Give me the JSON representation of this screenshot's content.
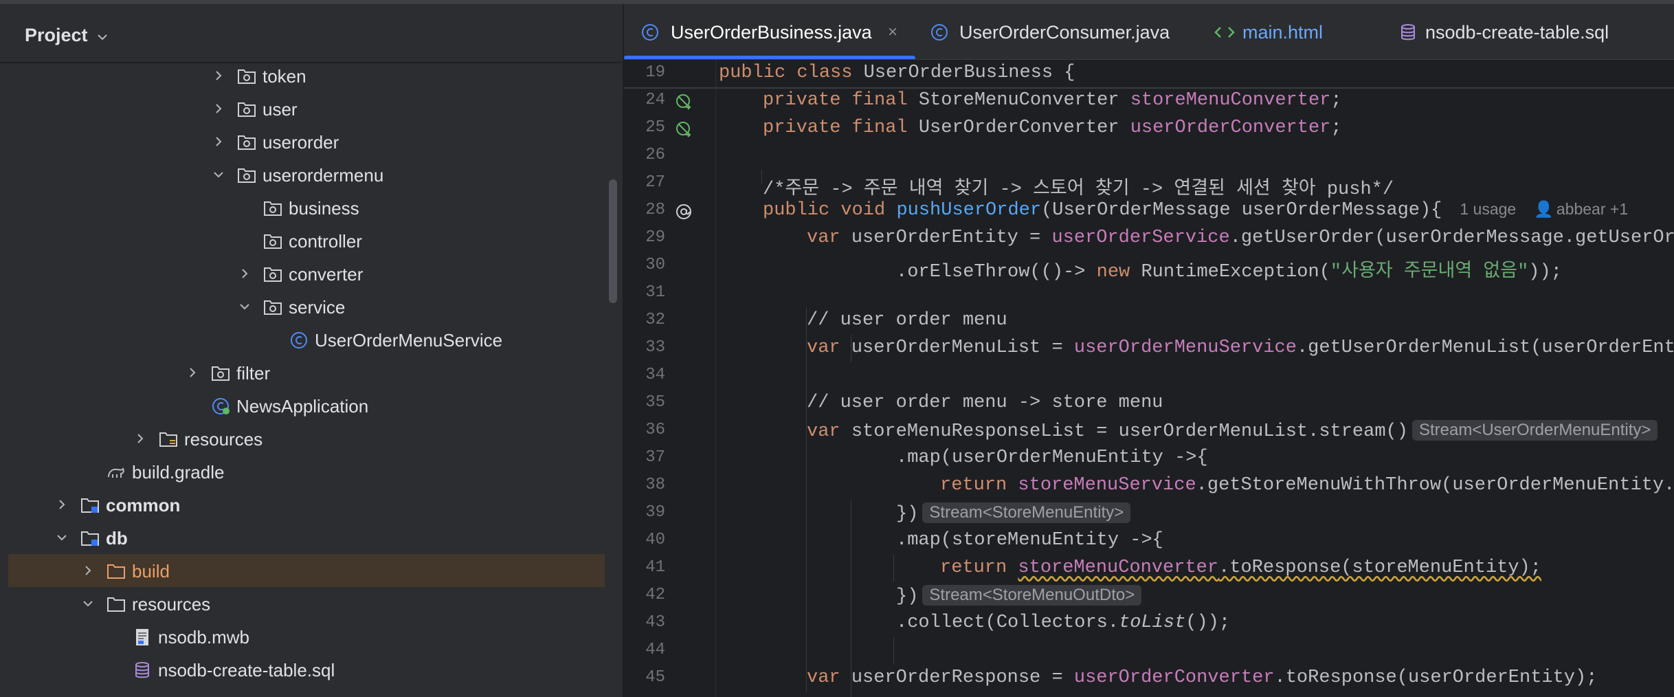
{
  "project_panel": {
    "title": "Project",
    "tree": [
      {
        "label": "token",
        "icon": "package-folder-icon",
        "expanded": false
      },
      {
        "label": "user",
        "icon": "package-folder-icon",
        "expanded": false
      },
      {
        "label": "userorder",
        "icon": "package-folder-icon",
        "expanded": false
      },
      {
        "label": "userordermenu",
        "icon": "package-folder-icon",
        "expanded": true
      },
      {
        "label": "business",
        "icon": "package-folder-icon"
      },
      {
        "label": "controller",
        "icon": "package-folder-icon"
      },
      {
        "label": "converter",
        "icon": "package-folder-icon",
        "expanded": false
      },
      {
        "label": "service",
        "icon": "package-folder-icon",
        "expanded": true
      },
      {
        "label": "UserOrderMenuService",
        "icon": "java-class-icon"
      },
      {
        "label": "filter",
        "icon": "package-folder-icon",
        "expanded": false
      },
      {
        "label": "NewsApplication",
        "icon": "spring-boot-class-icon"
      },
      {
        "label": "resources",
        "icon": "resources-folder-icon",
        "expanded": false
      },
      {
        "label": "build.gradle",
        "icon": "gradle-icon"
      },
      {
        "label": "common",
        "icon": "module-folder-icon",
        "expanded": false
      },
      {
        "label": "db",
        "icon": "module-folder-icon",
        "expanded": true
      },
      {
        "label": "build",
        "icon": "excluded-folder-icon",
        "expanded": false
      },
      {
        "label": "resources",
        "icon": "folder-icon",
        "expanded": true
      },
      {
        "label": "nsodb.mwb",
        "icon": "file-icon"
      },
      {
        "label": "nsodb-create-table.sql",
        "icon": "database-icon"
      }
    ]
  },
  "tabs": [
    {
      "label": "UserOrderBusiness.java",
      "icon": "java-class-icon",
      "active": true,
      "close": "×"
    },
    {
      "label": "UserOrderConsumer.java",
      "icon": "java-class-icon",
      "active": false
    },
    {
      "label": "main.html",
      "icon": "html-icon",
      "active": false
    },
    {
      "label": "nsodb-create-table.sql",
      "icon": "database-icon",
      "active": false
    }
  ],
  "code": {
    "ln19": "19",
    "ln24": "24",
    "ln25": "25",
    "ln26": "26",
    "ln27": "27",
    "ln28": "28",
    "ln29": "29",
    "ln30": "30",
    "ln31": "31",
    "ln32": "32",
    "ln33": "33",
    "ln34": "34",
    "ln35": "35",
    "ln36": "36",
    "ln37": "37",
    "ln38": "38",
    "ln39": "39",
    "ln40": "40",
    "ln41": "41",
    "ln42": "42",
    "ln43": "43",
    "ln44": "44",
    "ln45": "45",
    "l19_kw": "public class ",
    "l19_rest": "UserOrderBusiness {",
    "l24_kw": "private final ",
    "l24_type": "StoreMenuConverter ",
    "l24_field": "storeMenuConverter",
    "l24_end": ";",
    "l25_kw": "private final ",
    "l25_type": "UserOrderConverter ",
    "l25_field": "userOrderConverter",
    "l25_end": ";",
    "l27_comment": "/*주문 -> 주문 내역 찾기 -> 스토어 찾기 -> 연결된 세션 찾아 push*/",
    "l28_kw": "public void ",
    "l28_fn": "pushUserOrder",
    "l28_rest": "(UserOrderMessage userOrderMessage){",
    "l28_usage": "1 usage",
    "l28_author": "abbear +1",
    "l29_kw": "var ",
    "l29_a": "userOrderEntity = ",
    "l29_field": "userOrderService",
    "l29_b": ".getUserOrder(userOrderMessage.getUserOrd",
    "l30_a": ".orElseThrow(()-> ",
    "l30_kw": "new ",
    "l30_b": "RuntimeException(",
    "l30_str": "\"사용자 주문내역 없음\"",
    "l30_c": "));",
    "l32_comment": "// user order menu",
    "l33_kw": "var ",
    "l33_a": "userOrderMenuList = ",
    "l33_field": "userOrderMenuService",
    "l33_b": ".getUserOrderMenuList(userOrderEnti",
    "l35_comment": "// user order menu -> store menu",
    "l36_kw": "var ",
    "l36_a": "storeMenuResponseList = userOrderMenuList.stream()",
    "l36_hint": "Stream<UserOrderMenuEntity>",
    "l37": ".map(userOrderMenuEntity ->{",
    "l38_kw": "return ",
    "l38_field": "storeMenuService",
    "l38_b": ".getStoreMenuWithThrow(userOrderMenuEntity.g",
    "l39": "})",
    "l39_hint": "Stream<StoreMenuEntity>",
    "l40": ".map(storeMenuEntity ->{",
    "l41_kw": "return ",
    "l41_field": "storeMenuConverter",
    "l41_b": ".toResponse(storeMenuEntity);",
    "l42": "})",
    "l42_hint": "Stream<StoreMenuOutDto>",
    "l43_a": ".collect(Collectors.",
    "l43_i": "toList",
    "l43_b": "());",
    "l45_kw": "var ",
    "l45_a": "userOrderResponse = ",
    "l45_field": "userOrderConverter",
    "l45_b": ".toResponse(userOrderEntity);"
  },
  "colors": {
    "accent": "#3574f0",
    "keyword": "#cf8e6d",
    "field": "#c77dbb",
    "method": "#56a8f5",
    "string": "#6aab73",
    "comment": "#7a7e85",
    "selection": "#43362a"
  }
}
